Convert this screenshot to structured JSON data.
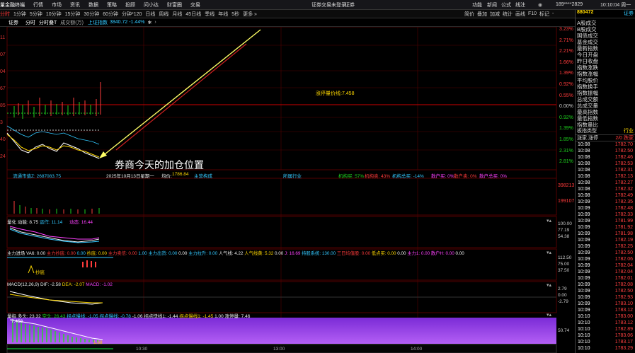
{
  "menu": {
    "app": "量金融终端",
    "items": [
      "行情",
      "市场",
      "资讯",
      "数据",
      "策略",
      "投顾",
      "问小达",
      "财富圈",
      "交易"
    ],
    "alert": "证券交易未登录",
    "alert2": "证券",
    "right": [
      "功能",
      "新闻",
      "公式",
      "线注"
    ],
    "phone": "189****2829",
    "time": "10:10:04 周一"
  },
  "timeframes": {
    "items": [
      "分时",
      "1分钟",
      "5分钟",
      "10分钟",
      "15分钟",
      "30分钟",
      "60分钟",
      "分钟*120",
      "日线",
      "周线",
      "月线",
      "45日线",
      "季线",
      "年线",
      "5秒",
      "更多 »"
    ],
    "active": "分时",
    "right": [
      "简价",
      "叠加",
      "加减",
      "统计",
      "画线",
      "F10",
      "标记",
      "-"
    ]
  },
  "info": {
    "security": "证券",
    "mode": "分时",
    "overlay_label": "分时叠T",
    "volume_label": "成交额(万)",
    "index_name": "上证指数",
    "index_value": "3840.72",
    "index_change": "-1.44%"
  },
  "price_axis": [
    "3.23%",
    "2.71%",
    "2.21%",
    "1.66%",
    "1.39%",
    "0.92%",
    "0.55%",
    "0.00%",
    "0.92%",
    "1.39%",
    "1.85%",
    "2.31%",
    "2.81%"
  ],
  "left_axis": [
    "11",
    "07",
    "04",
    "67",
    "85",
    "3",
    "40",
    "24",
    "15",
    "06",
    "07",
    "90",
    "88",
    "81"
  ],
  "chart_labels": {
    "mark_line": "涨停量价线:7.458",
    "annotation": "券商今天的加仓位置",
    "arrow_note": "价格坐标"
  },
  "status_strip": {
    "market_value_label": "流通市值Z:",
    "market_value": "2687083.75",
    "date": "2025年10月13日星期一",
    "avg_label": "均价:",
    "avg_value": "1786.84",
    "main_label": "主营构成",
    "industry_label": "所属行业",
    "inst1": "机构买: 57%",
    "inst2": "机构卖: 43%",
    "inst3": "机构总买: -14%",
    "ret1": "散户买: 0%",
    "ret2": "散户卖: 0%",
    "ret3": "散户总买: 0%"
  },
  "volume_axis": [
    "398213",
    "199107"
  ],
  "panel1": {
    "title": "量化",
    "l1": "动能: 8.75",
    "l2": "运作: 11.14",
    "l3": "动态: 16.44",
    "axis": [
      "100.00",
      "77.19",
      "54.38"
    ]
  },
  "panel2": {
    "title": "主力进场",
    "items": [
      "VA6: 0.00",
      "主力抄底: 0.00",
      "0.00",
      "抄底: 0.00",
      "主力卖信: 0.00",
      "1.00",
      "主力出货: 0.00",
      "0.00",
      "主力拉升: 0.00",
      "人气线: 4.22",
      "人气线黄: 5.32",
      "0.00",
      "J: 16.69",
      "持股系统: 130.00",
      "三日均值股: 0.00",
      "低点买: 0.00",
      "0.00",
      "主力1: 0.00",
      "散户H: 0.00",
      "0.00"
    ],
    "marker": "抄底",
    "axis": [
      "112.50",
      "75.00",
      "37.50"
    ]
  },
  "panel3": {
    "title": "MACD(12,26,9)",
    "dif": "DIF: -2.58",
    "dea": "DEA: -2.07",
    "macd": "MACD: -1.02",
    "axis": [
      "2.79",
      "0.00",
      "-2.79"
    ]
  },
  "panel4": {
    "title": "量指",
    "items": [
      "多头: 23.32",
      "空头: 26.43",
      "拐点慢线: -1.05",
      "拐点慢线: -0.78",
      "-1.06",
      "拐点快线1: -1.44",
      "拐点慢线1: -1.45",
      "1.00",
      "涨停量: 7.46"
    ],
    "top_mark": "7.458",
    "bottom_mark": "1.68",
    "axis": [
      "50.74"
    ]
  },
  "right_panel": {
    "code": "880472",
    "name": "证券",
    "list": [
      "A股成交",
      "B股成交",
      "国债成交",
      "基金成交",
      "最新指数",
      "今日开盘",
      "昨日收盘",
      "指数涨跌",
      "指数涨幅",
      "平均股价",
      "指数换手",
      "指数振幅",
      "总成交额",
      "总成交量",
      "最高指数",
      "最低指数",
      "指数量比",
      "板指类型"
    ],
    "type_value": "行业",
    "hdr": [
      "涨家.涨停",
      "2/0 跌家"
    ],
    "ticks": [
      [
        "10:08",
        "1782.70"
      ],
      [
        "10:08",
        "1782.50"
      ],
      [
        "10:08",
        "1782.46"
      ],
      [
        "10:08",
        "1782.53"
      ],
      [
        "10:08",
        "1782.31"
      ],
      [
        "10:08",
        "1782.13"
      ],
      [
        "10:08",
        "1782.27"
      ],
      [
        "10:08",
        "1782.32"
      ],
      [
        "10:08",
        "1782.49"
      ],
      [
        "10:09",
        "1782.35"
      ],
      [
        "10:09",
        "1782.48"
      ],
      [
        "10:09",
        "1782.33"
      ],
      [
        "10:09",
        "1781.99"
      ],
      [
        "10:09",
        "1781.92"
      ],
      [
        "10:09",
        "1781.98"
      ],
      [
        "10:09",
        "1782.19"
      ],
      [
        "10:09",
        "1782.25"
      ],
      [
        "10:09",
        "1782.50"
      ],
      [
        "10:09",
        "1782.06"
      ],
      [
        "10:09",
        "1782.04"
      ],
      [
        "10:09",
        "1782.04"
      ],
      [
        "10:09",
        "1782.01"
      ],
      [
        "10:09",
        "1782.08"
      ],
      [
        "10:09",
        "1782.50"
      ],
      [
        "10:09",
        "1782.93"
      ],
      [
        "10:09",
        "1783.10"
      ],
      [
        "10:09",
        "1783.12"
      ],
      [
        "10:10",
        "1783.00"
      ],
      [
        "10:10",
        "1783.12"
      ],
      [
        "10:10",
        "1782.89"
      ],
      [
        "10:10",
        "1783.06"
      ],
      [
        "10:10",
        "1783.17"
      ],
      [
        "10:10",
        "1783.29"
      ]
    ]
  },
  "time_axis": [
    "10:30",
    "13:00",
    "14:00"
  ],
  "colors": {
    "up": "#ff3b3b",
    "down": "#1ed21e",
    "accent": "#32c8ff",
    "annotation_arrow": "#ffff66",
    "trend": "#cc2020"
  }
}
